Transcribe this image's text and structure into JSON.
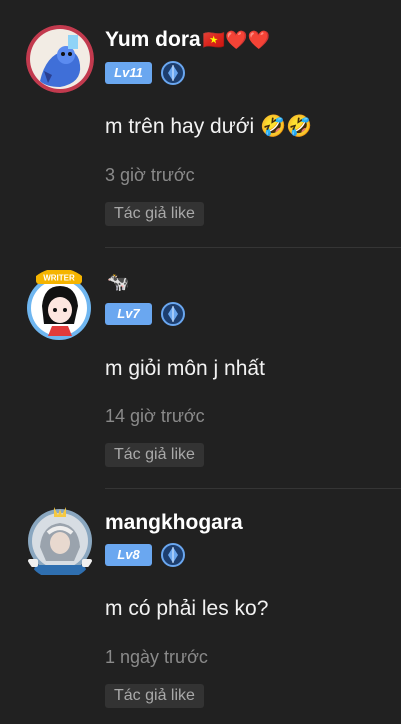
{
  "comments": [
    {
      "user": "Yum dora",
      "name_emoji": "🇻🇳❤️❤️",
      "level": "Lv11",
      "text": "m trên hay dưới 🤣🤣",
      "time": "3 giờ trước",
      "like_label": "Tác giả like",
      "avatar_icon": "blue-creature-avatar"
    },
    {
      "user": "",
      "name_emoji": "🐄",
      "level": "Lv7",
      "text": "m giỏi môn j nhất",
      "time": "14 giờ trước",
      "like_label": "Tác giả like",
      "avatar_icon": "anime-writer-avatar",
      "avatar_badge": "WRITER"
    },
    {
      "user": "mangkhogara",
      "name_emoji": "",
      "level": "Lv8",
      "text": "m có phải les ko?",
      "time": "1 ngày trước",
      "like_label": "Tác giả like",
      "avatar_icon": "silver-warrior-avatar"
    }
  ],
  "colors": {
    "background": "#212121",
    "level_badge": "#6aa7f0",
    "time_text": "#8a8a8a",
    "chip_background": "#333333"
  }
}
